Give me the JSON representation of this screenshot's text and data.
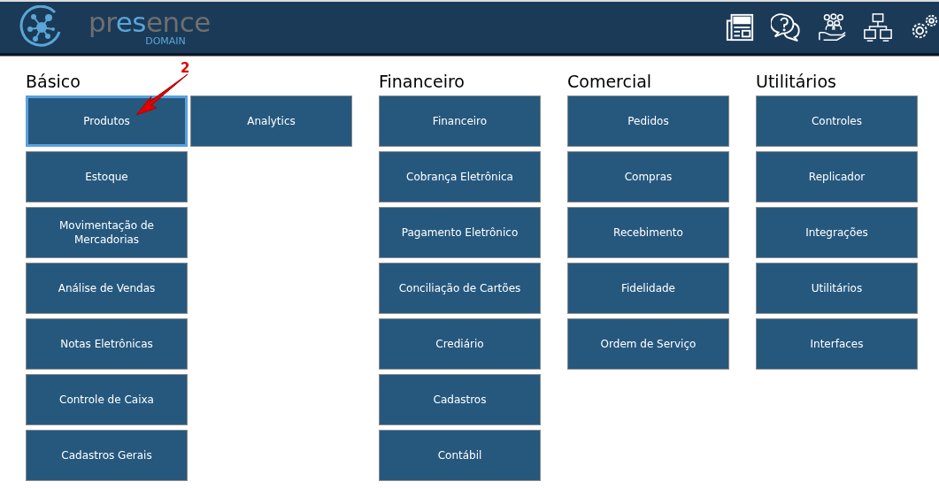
{
  "header": {
    "logo_text": "pr**es**ence",
    "logo_subtext": "DOMAIN"
  },
  "sections": [
    {
      "title": "Básico",
      "columns": [
        [
          {
            "label": "Produtos",
            "selected": true
          },
          {
            "label": "Estoque",
            "selected": false
          },
          {
            "label": "Movimentação de Mercadorias",
            "selected": false
          },
          {
            "label": "Análise de Vendas",
            "selected": false
          },
          {
            "label": "Notas Eletrônicas",
            "selected": false
          },
          {
            "label": "Controle de Caixa",
            "selected": false
          },
          {
            "label": "Cadastros Gerais",
            "selected": false
          }
        ],
        [
          {
            "label": "Analytics",
            "selected": false
          }
        ]
      ]
    },
    {
      "title": "Financeiro",
      "columns": [
        [
          {
            "label": "Financeiro",
            "selected": false
          },
          {
            "label": "Cobrança Eletrônica",
            "selected": false
          },
          {
            "label": "Pagamento Eletrônico",
            "selected": false
          },
          {
            "label": "Conciliação de Cartões",
            "selected": false
          },
          {
            "label": "Crediário",
            "selected": false
          },
          {
            "label": "Cadastros",
            "selected": false
          },
          {
            "label": "Contábil",
            "selected": false
          }
        ]
      ]
    },
    {
      "title": "Comercial",
      "columns": [
        [
          {
            "label": "Pedidos",
            "selected": false
          },
          {
            "label": "Compras",
            "selected": false
          },
          {
            "label": "Recebimento",
            "selected": false
          },
          {
            "label": "Fidelidade",
            "selected": false
          },
          {
            "label": "Ordem de Serviço",
            "selected": false
          }
        ]
      ]
    },
    {
      "title": "Utilitários",
      "columns": [
        [
          {
            "label": "Controles",
            "selected": false
          },
          {
            "label": "Replicador",
            "selected": false
          },
          {
            "label": "Integrações",
            "selected": false
          },
          {
            "label": "Utilitários",
            "selected": false
          },
          {
            "label": "Interfaces",
            "selected": false
          }
        ]
      ]
    }
  ],
  "annotation": {
    "label": "2"
  }
}
